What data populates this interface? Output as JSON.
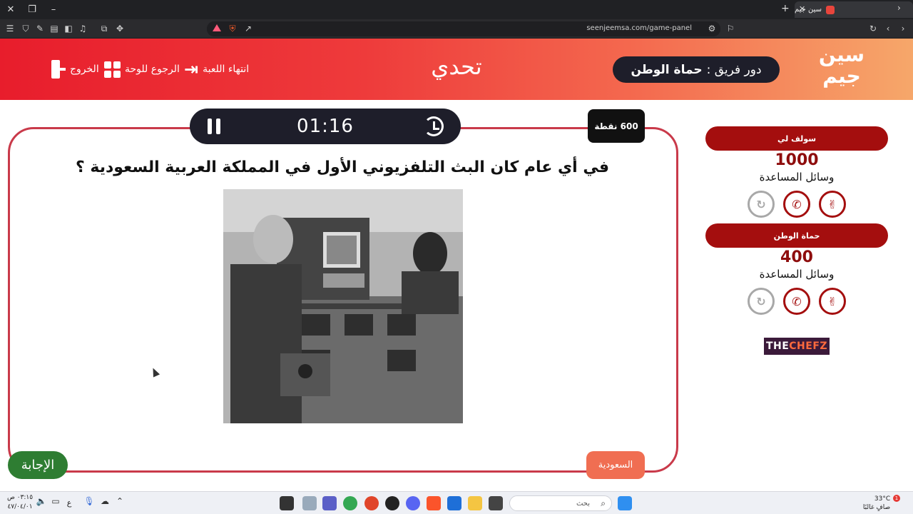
{
  "browser": {
    "tab_title": "سين جيم",
    "url": "seenjeemsa.com/game-panel",
    "shield_count": "2"
  },
  "header": {
    "logo_line1": "سين",
    "logo_line2": "جيم",
    "turn_prefix": "دور فريق :",
    "turn_team": "حماة الوطن",
    "title": "تحدي",
    "end_game": "انتهاء اللعبة",
    "back_to_board": "الرجوع للوحة",
    "exit": "الخروج"
  },
  "question_panel": {
    "timer": "01:16",
    "points": "600 نقطة",
    "question": "في أي عام كان البث التلفزيوني الأول في المملكة العربية السعودية ؟",
    "answer_label": "الإجابة",
    "category": "السعودية"
  },
  "teams": [
    {
      "name": "سولف لي",
      "score": "1000",
      "aids_label": "وسائل المساعدة",
      "aids": [
        {
          "icon": "two-answers-icon",
          "glyph": "✌",
          "used": false
        },
        {
          "icon": "phone-icon",
          "glyph": "✆",
          "used": false
        },
        {
          "icon": "rest-icon",
          "glyph": "↻",
          "used": true
        }
      ]
    },
    {
      "name": "حماة الوطن",
      "score": "400",
      "aids_label": "وسائل المساعدة",
      "aids": [
        {
          "icon": "two-answers-icon",
          "glyph": "✌",
          "used": false
        },
        {
          "icon": "phone-icon",
          "glyph": "✆",
          "used": false
        },
        {
          "icon": "rest-icon",
          "glyph": "↻",
          "used": true
        }
      ]
    }
  ],
  "sponsor": {
    "part1": "THE ",
    "part2": "CHEFZ"
  },
  "taskbar": {
    "search_placeholder": "بحث",
    "weather_temp": "33°C",
    "weather_desc": "صافٍ غالبًا",
    "time": "٠٣:١٥ ص",
    "date": "٤٧/٠٤/٠١",
    "lang": "ع",
    "notification_count": "1"
  },
  "colors": {
    "header_start": "#e81d2c",
    "header_end": "#f6a76a",
    "accent_dark": "#1e1e2a",
    "team_red": "#a40e0e",
    "answer_green": "#2e7d32",
    "category_orange": "#f06e52"
  }
}
